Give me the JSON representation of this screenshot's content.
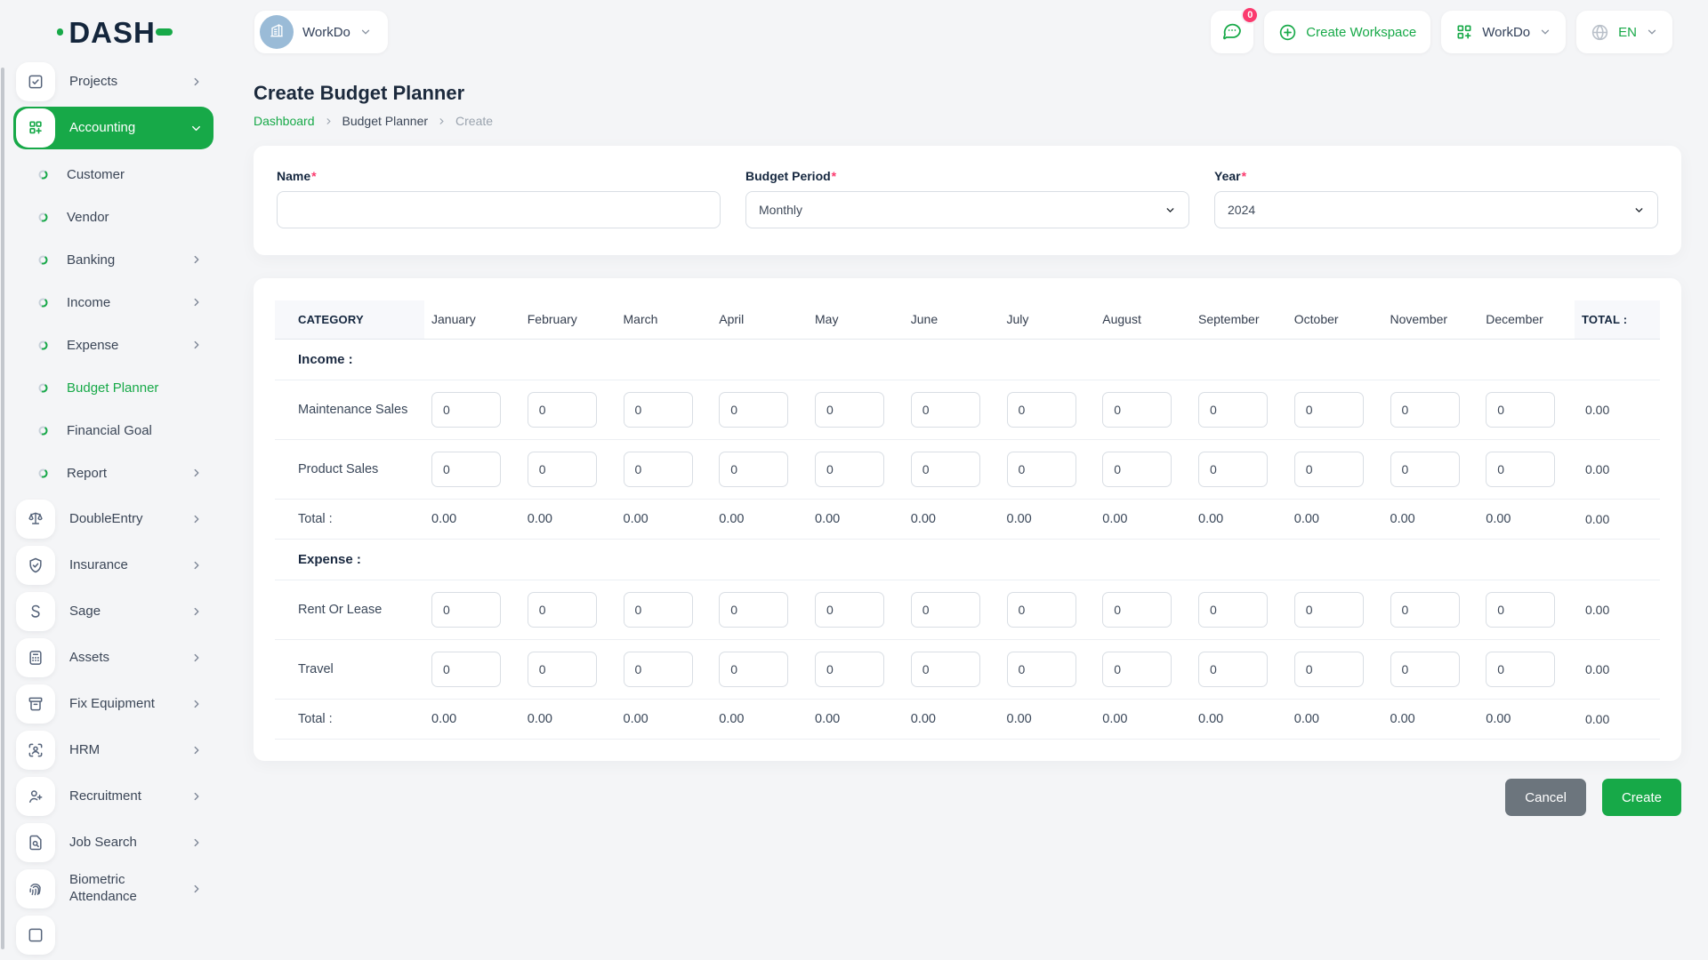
{
  "brand": {
    "name": "DASH",
    "accent": "#17a948"
  },
  "header": {
    "workspace": {
      "label": "WorkDo"
    },
    "messages_badge": "0",
    "create_workspace_label": "Create Workspace",
    "app_switcher_label": "WorkDo",
    "language_label": "EN"
  },
  "sidebar": {
    "items": [
      {
        "type": "main",
        "label": "Projects",
        "icon": "checkbox",
        "arrow": true
      },
      {
        "type": "main",
        "label": "Accounting",
        "icon": "grid-plus",
        "active": true,
        "expanded": true
      },
      {
        "type": "sub",
        "label": "Customer"
      },
      {
        "type": "sub",
        "label": "Vendor"
      },
      {
        "type": "sub",
        "label": "Banking",
        "arrow": true
      },
      {
        "type": "sub",
        "label": "Income",
        "arrow": true
      },
      {
        "type": "sub",
        "label": "Expense",
        "arrow": true
      },
      {
        "type": "sub",
        "label": "Budget Planner",
        "active": true
      },
      {
        "type": "sub",
        "label": "Financial Goal"
      },
      {
        "type": "sub",
        "label": "Report",
        "arrow": true
      },
      {
        "type": "main",
        "label": "DoubleEntry",
        "icon": "scale",
        "arrow": true
      },
      {
        "type": "main",
        "label": "Insurance",
        "icon": "shield-check",
        "arrow": true
      },
      {
        "type": "main",
        "label": "Sage",
        "icon": "sage-s",
        "arrow": true
      },
      {
        "type": "main",
        "label": "Assets",
        "icon": "calculator",
        "arrow": true
      },
      {
        "type": "main",
        "label": "Fix Equipment",
        "icon": "archive-box",
        "arrow": true
      },
      {
        "type": "main",
        "label": "HRM",
        "icon": "user-scan",
        "arrow": true
      },
      {
        "type": "main",
        "label": "Recruitment",
        "icon": "user-plus",
        "arrow": true
      },
      {
        "type": "main",
        "label": "Job Search",
        "icon": "file-search",
        "arrow": true
      },
      {
        "type": "main",
        "label": "Biometric Attendance",
        "icon": "fingerprint",
        "arrow": true
      },
      {
        "type": "main",
        "label": "",
        "icon": "partial",
        "arrow": false
      }
    ]
  },
  "page": {
    "title": "Create Budget Planner",
    "breadcrumb": {
      "home": "Dashboard",
      "section": "Budget Planner",
      "current": "Create"
    }
  },
  "form": {
    "required_mark": "*",
    "name": {
      "label": "Name",
      "value": "",
      "placeholder": ""
    },
    "budget_period": {
      "label": "Budget Period",
      "value": "Monthly"
    },
    "year": {
      "label": "Year",
      "value": "2024"
    }
  },
  "table": {
    "columns": {
      "category": "CATEGORY",
      "months": [
        "January",
        "February",
        "March",
        "April",
        "May",
        "June",
        "July",
        "August",
        "September",
        "October",
        "November",
        "December"
      ],
      "total": "TOTAL :"
    },
    "sections": [
      {
        "label": "Income :",
        "rows": [
          {
            "label": "Maintenance Sales",
            "values": [
              "0",
              "0",
              "0",
              "0",
              "0",
              "0",
              "0",
              "0",
              "0",
              "0",
              "0",
              "0"
            ],
            "total": "0.00"
          },
          {
            "label": "Product Sales",
            "values": [
              "0",
              "0",
              "0",
              "0",
              "0",
              "0",
              "0",
              "0",
              "0",
              "0",
              "0",
              "0"
            ],
            "total": "0.00"
          }
        ],
        "total_row": {
          "label": "Total :",
          "values": [
            "0.00",
            "0.00",
            "0.00",
            "0.00",
            "0.00",
            "0.00",
            "0.00",
            "0.00",
            "0.00",
            "0.00",
            "0.00",
            "0.00"
          ],
          "total": "0.00"
        }
      },
      {
        "label": "Expense :",
        "rows": [
          {
            "label": "Rent Or Lease",
            "values": [
              "0",
              "0",
              "0",
              "0",
              "0",
              "0",
              "0",
              "0",
              "0",
              "0",
              "0",
              "0"
            ],
            "total": "0.00"
          },
          {
            "label": "Travel",
            "values": [
              "0",
              "0",
              "0",
              "0",
              "0",
              "0",
              "0",
              "0",
              "0",
              "0",
              "0",
              "0"
            ],
            "total": "0.00"
          }
        ],
        "total_row": {
          "label": "Total :",
          "values": [
            "0.00",
            "0.00",
            "0.00",
            "0.00",
            "0.00",
            "0.00",
            "0.00",
            "0.00",
            "0.00",
            "0.00",
            "0.00",
            "0.00"
          ],
          "total": "0.00"
        }
      }
    ]
  },
  "actions": {
    "cancel_label": "Cancel",
    "create_label": "Create"
  }
}
